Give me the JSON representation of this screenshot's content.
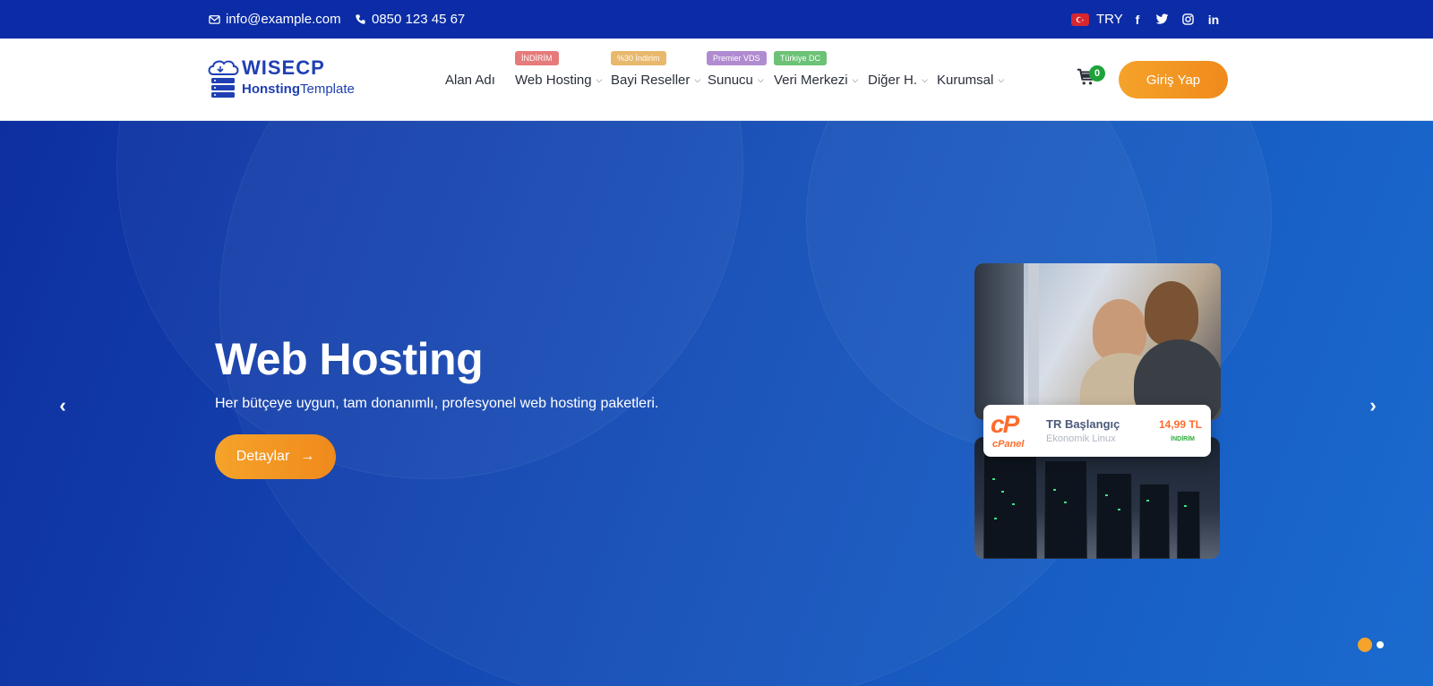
{
  "topbar": {
    "email": "info@example.com",
    "phone": "0850 123 45 67",
    "currency": "TRY",
    "socials": [
      "facebook-icon",
      "twitter-icon",
      "instagram-icon",
      "linkedin-icon"
    ]
  },
  "header": {
    "logo": {
      "line1": "WISECP",
      "line2_bold": "Honsting",
      "line2_rest": "Template"
    },
    "nav": [
      {
        "label": "Alan Adı",
        "badge": "",
        "has_chevron": false
      },
      {
        "label": "Web Hosting",
        "badge": "İNDİRİM",
        "badge_color": "#e77a7a",
        "has_chevron": true
      },
      {
        "label": "Bayi Reseller",
        "badge": "%30 İndirim",
        "badge_color": "#e8b86b",
        "has_chevron": true
      },
      {
        "label": "Sunucu",
        "badge": "Premier VDS",
        "badge_color": "#b18bd0",
        "has_chevron": true
      },
      {
        "label": "Veri Merkezi",
        "badge": "Türkiye DC",
        "badge_color": "#6cc276",
        "has_chevron": true
      },
      {
        "label": "Diğer H.",
        "badge": "",
        "has_chevron": true
      },
      {
        "label": "Kurumsal",
        "badge": "",
        "has_chevron": true
      }
    ],
    "cart_count": "0",
    "login_label": "Giriş Yap"
  },
  "hero": {
    "title": "Web Hosting",
    "subtitle": "Her bütçeye uygun, tam donanımlı, profesyonel web hosting paketleri.",
    "cta_label": "Detaylar",
    "cta_arrow": "→",
    "prev_arrow": "‹",
    "next_arrow": "›",
    "price_card": {
      "logo_main": "cP",
      "logo_small": "cPanel",
      "name": "TR Başlangıç",
      "sub": "Ekonomik Linux",
      "price": "14,99 TL",
      "badge": "İNDİRİM"
    },
    "slides_total": 2,
    "active_slide": 1
  },
  "colors": {
    "topbar": "#0b2ca6",
    "accent": "#f5a32a",
    "hero": "#1650b8"
  }
}
